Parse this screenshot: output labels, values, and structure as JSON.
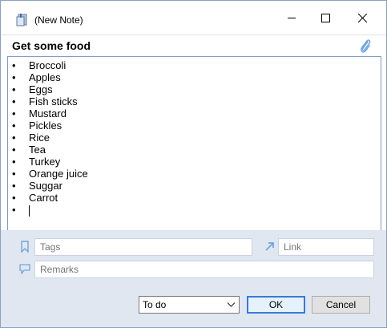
{
  "window": {
    "title": "(New Note)"
  },
  "note": {
    "title": "Get some food",
    "bullet": "•",
    "items": [
      "Broccoli",
      "Apples",
      "Eggs",
      "Fish sticks",
      "Mustard",
      "Pickles",
      "Rice",
      "Tea",
      "Turkey",
      "Orange juice",
      "Suggar",
      "Carrot",
      ""
    ]
  },
  "fields": {
    "tags_placeholder": "Tags",
    "link_placeholder": "Link",
    "remarks_placeholder": "Remarks"
  },
  "status": {
    "selected": "To do"
  },
  "buttons": {
    "ok": "OK",
    "cancel": "Cancel"
  },
  "icons": {
    "app": "note-app-icon",
    "attach": "paperclip-icon",
    "tags": "bookmark-icon",
    "link": "link-arrow-icon",
    "remarks": "speech-bubble-icon"
  },
  "colors": {
    "accent": "#3a79d6",
    "lower_panel": "#e1e7f1",
    "icon_blue": "#6fa5dd"
  }
}
